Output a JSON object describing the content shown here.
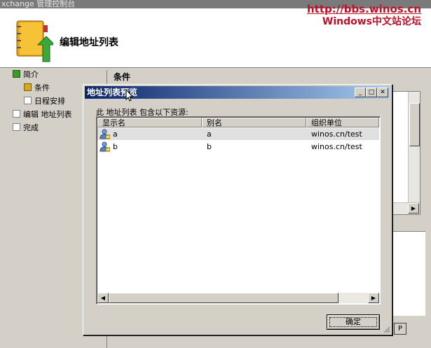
{
  "window": {
    "title": "xchange 管理控制台"
  },
  "watermark": {
    "url": "http://bbs.winos.cn",
    "name": "Windows中文站论坛"
  },
  "wizard": {
    "title": "编辑地址列表"
  },
  "nav": {
    "items": [
      {
        "label": "简介",
        "state": "done"
      },
      {
        "label": "条件",
        "state": "current"
      },
      {
        "label": "日程安排",
        "state": "pending"
      },
      {
        "label": "编辑 地址列表",
        "state": "pending"
      },
      {
        "label": "完成",
        "state": "pending"
      }
    ]
  },
  "content": {
    "section_label": "条件",
    "help_button": "P"
  },
  "dialog": {
    "title": "地址列表预览",
    "description": "此 地址列表 包含以下资源:",
    "columns": [
      "显示名",
      "别名",
      "组织单位"
    ],
    "rows": [
      {
        "display_name": "a",
        "alias": "a",
        "ou": "winos.cn/test",
        "selected": true
      },
      {
        "display_name": "b",
        "alias": "b",
        "ou": "winos.cn/test",
        "selected": false
      }
    ],
    "ok_label": "确定"
  },
  "colors": {
    "title_start": "#0a246a",
    "title_end": "#a6caf0",
    "watermark": "#c0102a"
  }
}
